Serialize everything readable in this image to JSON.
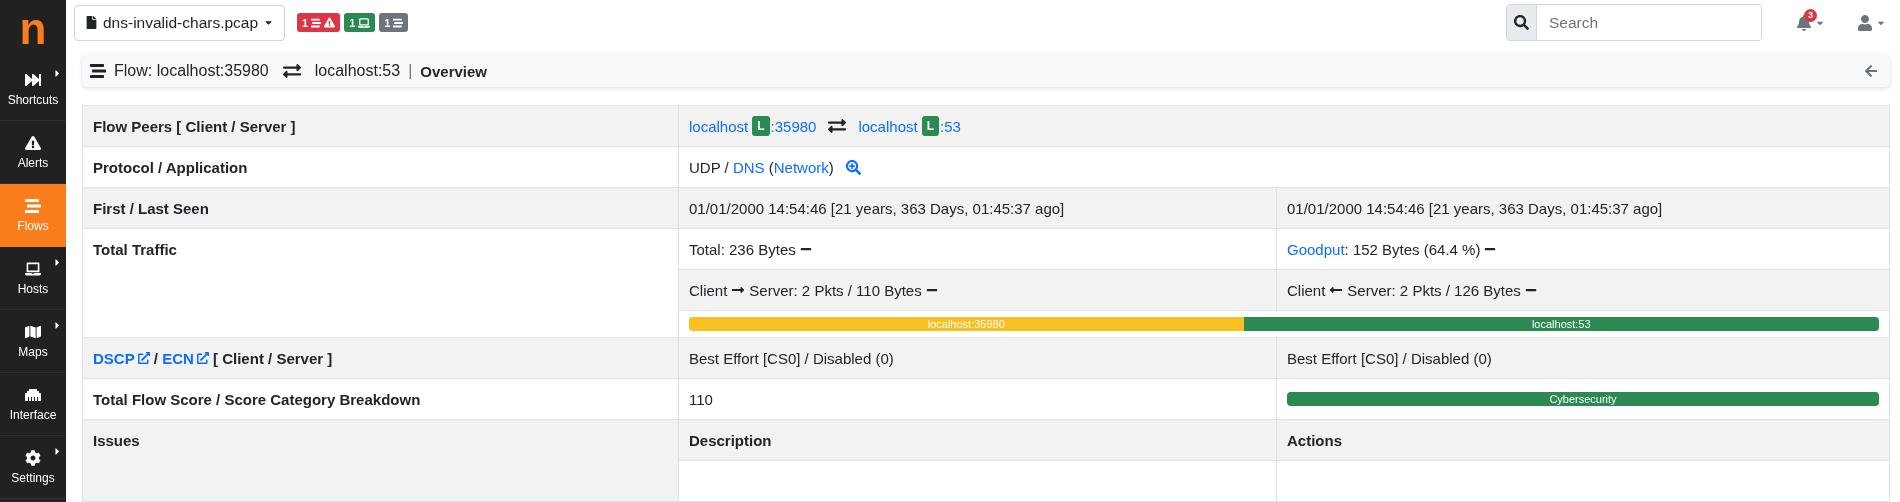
{
  "sidebar": {
    "logo": "n",
    "items": [
      {
        "label": "Shortcuts",
        "kind": "shortcuts",
        "has_submenu": true,
        "selected": false
      },
      {
        "label": "Alerts",
        "kind": "alerts",
        "has_submenu": false,
        "selected": false
      },
      {
        "label": "Flows",
        "kind": "flows",
        "has_submenu": false,
        "selected": true
      },
      {
        "label": "Hosts",
        "kind": "hosts",
        "has_submenu": true,
        "selected": false
      },
      {
        "label": "Maps",
        "kind": "maps",
        "has_submenu": true,
        "selected": false
      },
      {
        "label": "Interface",
        "kind": "interface",
        "has_submenu": false,
        "selected": false
      },
      {
        "label": "Settings",
        "kind": "settings",
        "has_submenu": true,
        "selected": false
      }
    ]
  },
  "topbar": {
    "file": "dns-invalid-chars.pcap",
    "badges": [
      {
        "count": "1",
        "kind": "alerts",
        "color": "#dc3545"
      },
      {
        "count": "1",
        "kind": "hosts",
        "color": "#2a8a52"
      },
      {
        "count": "1",
        "kind": "flows",
        "color": "#6c757d"
      }
    ],
    "search": {
      "placeholder": "Search"
    },
    "notifications": "3"
  },
  "flow_header": {
    "client": "Flow: localhost:35980",
    "server": "localhost:53",
    "separator": "|",
    "page": "Overview"
  },
  "table": {
    "rows": [
      {
        "kind": "peers",
        "label": [
          {
            "kind": "text",
            "text": "Flow Peers [ Client / Server ]"
          }
        ],
        "client": {
          "host": "localhost",
          "badge": "L",
          "port": ":35980"
        },
        "server": {
          "host": "localhost",
          "badge": "L",
          "port": ":53"
        }
      },
      {
        "kind": "wide",
        "label": [
          {
            "kind": "text",
            "text": "Protocol / Application"
          }
        ],
        "value": [
          {
            "kind": "text",
            "text": "UDP / "
          },
          {
            "kind": "link",
            "text": "DNS"
          },
          {
            "kind": "text",
            "text": " ("
          },
          {
            "kind": "link",
            "text": "Network"
          },
          {
            "kind": "text",
            "text": ")"
          }
        ],
        "search_icon": true
      },
      {
        "kind": "pair",
        "label": [
          {
            "kind": "text",
            "text": "First / Last Seen"
          }
        ],
        "cells": [
          [
            {
              "kind": "text",
              "text": "01/01/2000 14:54:46 [21 years, 363 Days, 01:45:37 ago]"
            }
          ],
          [
            {
              "kind": "text",
              "text": "01/01/2000 14:54:46 [21 years, 363 Days, 01:45:37 ago]"
            }
          ]
        ]
      },
      {
        "kind": "traffic",
        "label": [
          {
            "kind": "text",
            "text": "Total Traffic"
          }
        ],
        "lines": [
          [
            [
              {
                "kind": "text",
                "text": "Total: 236 Bytes"
              },
              {
                "kind": "steady"
              }
            ],
            [
              {
                "kind": "link",
                "text": "Goodput"
              },
              {
                "kind": "text",
                "text": ": 152 Bytes (64.4 %)"
              },
              {
                "kind": "steady"
              }
            ]
          ],
          [
            [
              {
                "kind": "text",
                "text": "Client"
              },
              {
                "kind": "arrow_right"
              },
              {
                "kind": "text",
                "text": "Server: 2 Pkts / 110 Bytes"
              },
              {
                "kind": "steady"
              }
            ],
            [
              {
                "kind": "text",
                "text": "Client"
              },
              {
                "kind": "arrow_left"
              },
              {
                "kind": "text",
                "text": "Server: 2 Pkts / 126 Bytes"
              },
              {
                "kind": "steady"
              }
            ]
          ]
        ],
        "bar": [
          {
            "label": "localhost:35980",
            "level": 0.466,
            "color": "#f8c022"
          },
          {
            "label": "localhost:53",
            "level": 0.534,
            "color": "#2a8a52"
          }
        ]
      },
      {
        "kind": "pair",
        "label": [
          {
            "kind": "link_external",
            "text": "DSCP"
          },
          {
            "kind": "text",
            "text": " / "
          },
          {
            "kind": "link_external",
            "text": "ECN"
          },
          {
            "kind": "text",
            "text": " [ Client / Server ]"
          }
        ],
        "cells": [
          [
            {
              "kind": "text",
              "text": "Best Effort [CS0] / Disabled (0)"
            }
          ],
          [
            {
              "kind": "text",
              "text": "Best Effort [CS0] / Disabled (0)"
            }
          ]
        ]
      },
      {
        "kind": "score",
        "label": [
          {
            "kind": "text",
            "text": "Total Flow Score / Score Category Breakdown"
          }
        ],
        "value": "110",
        "bar": [
          {
            "label": "Cybersecurity",
            "level": 1,
            "color": "#2a8a52"
          }
        ]
      },
      {
        "kind": "header",
        "label": [
          {
            "kind": "text",
            "text": "Issues"
          }
        ],
        "columns": [
          "Description",
          "Actions"
        ]
      }
    ]
  }
}
